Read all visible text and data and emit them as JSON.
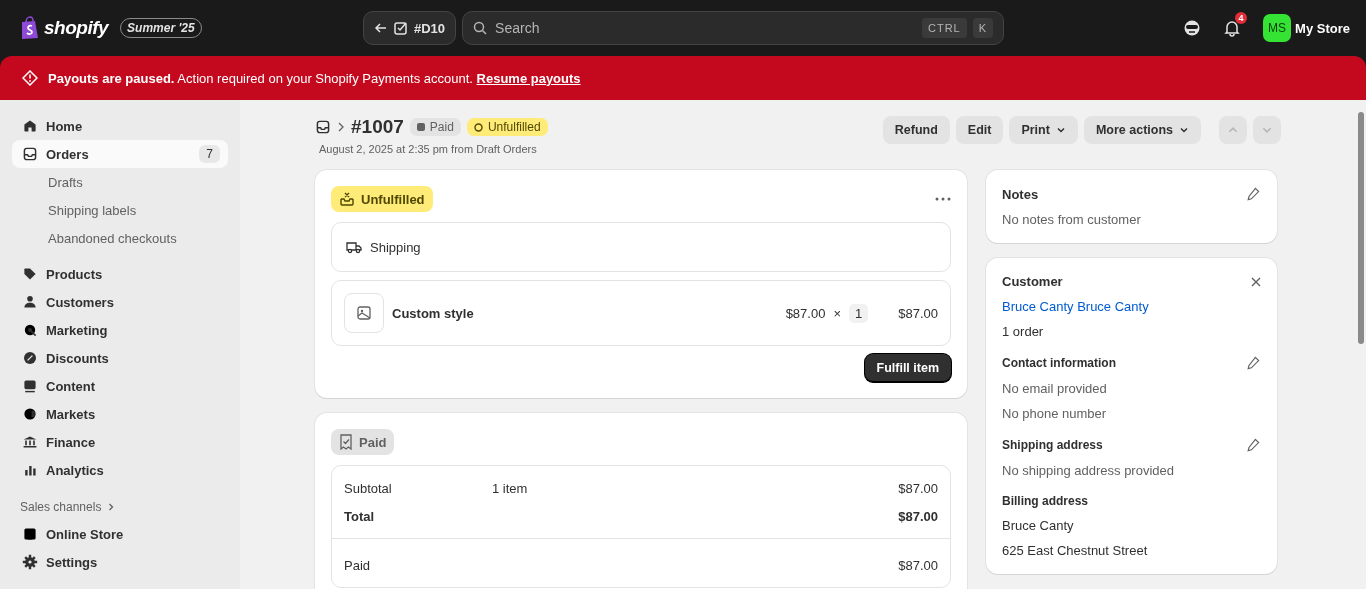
{
  "topbar": {
    "logo": "shopify",
    "edition": "Summer '25",
    "back_chip": "#D10",
    "search": {
      "placeholder": "Search"
    },
    "shortcut": [
      "CTRL",
      "K"
    ],
    "notification_count": "4",
    "avatar": "MS",
    "store": "My Store"
  },
  "banner": {
    "text": "**Payouts are paused.** Action required on your Shopify Payments account.",
    "link": "Resume payouts"
  },
  "sidebar": {
    "items": [
      {
        "label": "Home",
        "selected": false
      },
      {
        "label": "Orders",
        "selected": true,
        "badge": "7",
        "children": [
          {
            "label": "Drafts"
          },
          {
            "label": "Shipping labels"
          },
          {
            "label": "Abandoned checkouts"
          }
        ]
      },
      {
        "label": "Products",
        "selected": false
      },
      {
        "label": "Customers",
        "selected": false
      },
      {
        "label": "Marketing",
        "selected": false
      },
      {
        "label": "Discounts",
        "selected": false
      },
      {
        "label": "Content",
        "selected": false
      },
      {
        "label": "Markets",
        "selected": false
      },
      {
        "label": "Finance",
        "selected": false
      },
      {
        "label": "Analytics",
        "selected": false
      }
    ],
    "section": "Sales channels",
    "channel_items": [
      {
        "label": "Online Store"
      }
    ],
    "settings": {
      "label": "Settings"
    }
  },
  "order": {
    "number": "#1007",
    "badges": [
      {
        "label": "Paid",
        "kind": "paid"
      },
      {
        "label": "Unfulfilled",
        "kind": "unfulfilled"
      }
    ],
    "subtitle": "August 2, 2025 at 2:35 pm from Draft Orders",
    "actions": [
      {
        "label": "Refund",
        "kind": "button"
      },
      {
        "label": "Edit",
        "kind": "button"
      },
      {
        "label": "Print",
        "kind": "dropdown"
      },
      {
        "label": "More actions",
        "kind": "dropdown"
      }
    ],
    "nav": {
      "previous_disabled": true,
      "next_disabled": true
    }
  },
  "fulfillment": {
    "status": "Unfulfilled",
    "method": "Shipping",
    "line_item": {
      "name": "Custom style",
      "price": "$87.00",
      "times": "×",
      "quantity": "1",
      "total": "$87.00"
    },
    "button": "Fulfill item"
  },
  "payment": {
    "status": "Paid",
    "rows": [
      {
        "label": "Subtotal",
        "detail": "1 item",
        "amount": "$87.00",
        "bold": false
      },
      {
        "label": "Total",
        "amount": "$87.00",
        "bold": true
      }
    ],
    "paid_row": {
      "label": "Paid",
      "amount": "$87.00"
    }
  },
  "notes": {
    "title": "Notes",
    "text": "No notes from customer"
  },
  "customer": {
    "title": "Customer",
    "name": "Bruce Canty Bruce Canty",
    "orders": "1 order",
    "sections": [
      {
        "title": "Contact information",
        "editable": true,
        "lines": [
          "No email provided",
          "No phone number"
        ]
      },
      {
        "title": "Shipping address",
        "editable": true,
        "lines": [
          "No shipping address provided"
        ]
      },
      {
        "title": "Billing address",
        "editable": false,
        "lines": [
          "Bruce Canty",
          "625 East Chestnut Street"
        ]
      }
    ]
  }
}
